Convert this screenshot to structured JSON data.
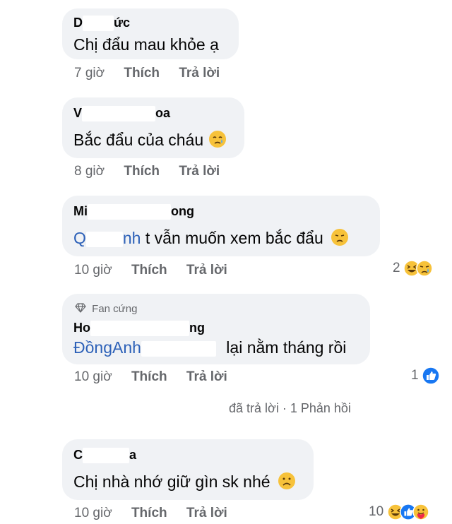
{
  "comments": [
    {
      "author_visible": "D",
      "author_tail": "ức",
      "text": "Chị đẩu mau khỏe ạ",
      "time": "7 giờ",
      "like": "Thích",
      "reply": "Trả lời"
    },
    {
      "author_visible": "V",
      "author_tail": "oa",
      "text": "Bắc đẩu của cháu",
      "time": "8 giờ",
      "like": "Thích",
      "reply": "Trả lời"
    },
    {
      "author_visible": "Mi",
      "author_tail": "ong",
      "mention_head": "Q",
      "mention_tail": "nh",
      "text": " t vẫn muốn xem bắc đẩu",
      "time": "10 giờ",
      "like": "Thích",
      "reply": "Trả lời",
      "reaction_count": "2"
    },
    {
      "badge": "Fan cứng",
      "author_visible": "Ho",
      "author_tail": "ng",
      "mention_head": "Đồng",
      "mention_tail": "Anh",
      "text": " lại nằm tháng rồi",
      "time": "10 giờ",
      "like": "Thích",
      "reply": "Trả lời",
      "reaction_count": "1"
    },
    {
      "author_visible": "C",
      "author_tail": "a",
      "text": "Chị nhà nhớ giữ gìn sk nhé",
      "time": "10 giờ",
      "like": "Thích",
      "reply": "Trả lời",
      "reaction_count": "10"
    }
  ],
  "replies_link": "đã trả lời · 1 Phản hồi",
  "colors": {
    "bubble": "#f0f2f5",
    "meta": "#65676b",
    "mention": "#2d61b8",
    "like_blue": "#1877f2"
  },
  "icons": [
    "crying-emoji",
    "sad-emoji",
    "haha-emoji",
    "like-reaction-icon",
    "frown-emoji",
    "diamond-icon",
    "care-emoji"
  ]
}
